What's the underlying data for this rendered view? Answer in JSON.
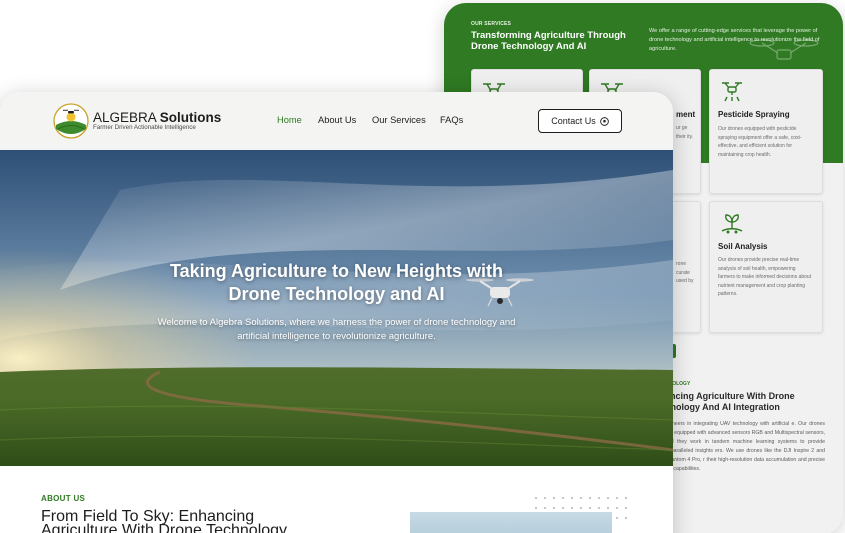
{
  "back_window": {
    "eyebrow": "OUR SERVICES",
    "title": "Transforming Agriculture Through Drone Technology And AI",
    "description": "We offer a range of cutting-edge services that leverage the power of drone technology and artificial intelligence to revolutionize the field of agriculture.",
    "cards": [
      {
        "title": "",
        "text": "",
        "icon": "drone-icon"
      },
      {
        "title": "ment",
        "text": "ur ge their ity.",
        "icon": "drone-icon"
      },
      {
        "title": "Pesticide Spraying",
        "text": "Our drones equipped with pesticide spraying equipment offer a safe, cost-effective, and efficient solution for maintaining crop health.",
        "icon": "sprayer-drone-icon"
      },
      {
        "title": "",
        "text": "rone curate used by",
        "icon": ""
      },
      {
        "title": "Soil Analysis",
        "text": "Our drones provide precise real-time analysis of soil health, empowering farmers to make informed decisions about nutrient management and crop planting patterns.",
        "icon": "sprout-icon"
      }
    ],
    "section_eyebrow": "HNOLOGY",
    "section_title": "ancing Agriculture With Drone hnology And AI Integration",
    "section_body": "pioneers in integrating UAV technology with artificial e. Our drones are equipped with advanced sensors RGB and Multispectral sensors, and they work in tandem machine learning systems to provide unparalleled insights ers. We use drones like the DJI Inspire 2 and Phantom 4 Pro, r their high-resolution data accumulation and precise ing capabilities."
  },
  "nav": {
    "brand_name": "ALGEBRA",
    "brand_bold": "Solutions",
    "tagline": "Farmer Driven Actionable Intelligence",
    "links": [
      "Home",
      "About Us",
      "Our Services",
      "FAQs"
    ],
    "contact_label": "Contact Us"
  },
  "hero": {
    "title_line1": "Taking Agriculture to New Heights with",
    "title_line2": "Drone Technology and AI",
    "subtitle_line1": "Welcome to Algebra Solutions, where we harness the power of drone technology and",
    "subtitle_line2": "artificial intelligence to revolutionize agriculture."
  },
  "about": {
    "eyebrow": "ABOUT US",
    "title_line1": "From Field To Sky: Enhancing",
    "title_line2": "Agriculture With Drone Technology"
  },
  "colors": {
    "brand_green": "#2f7a23",
    "text_dark": "#1d1d1d"
  }
}
